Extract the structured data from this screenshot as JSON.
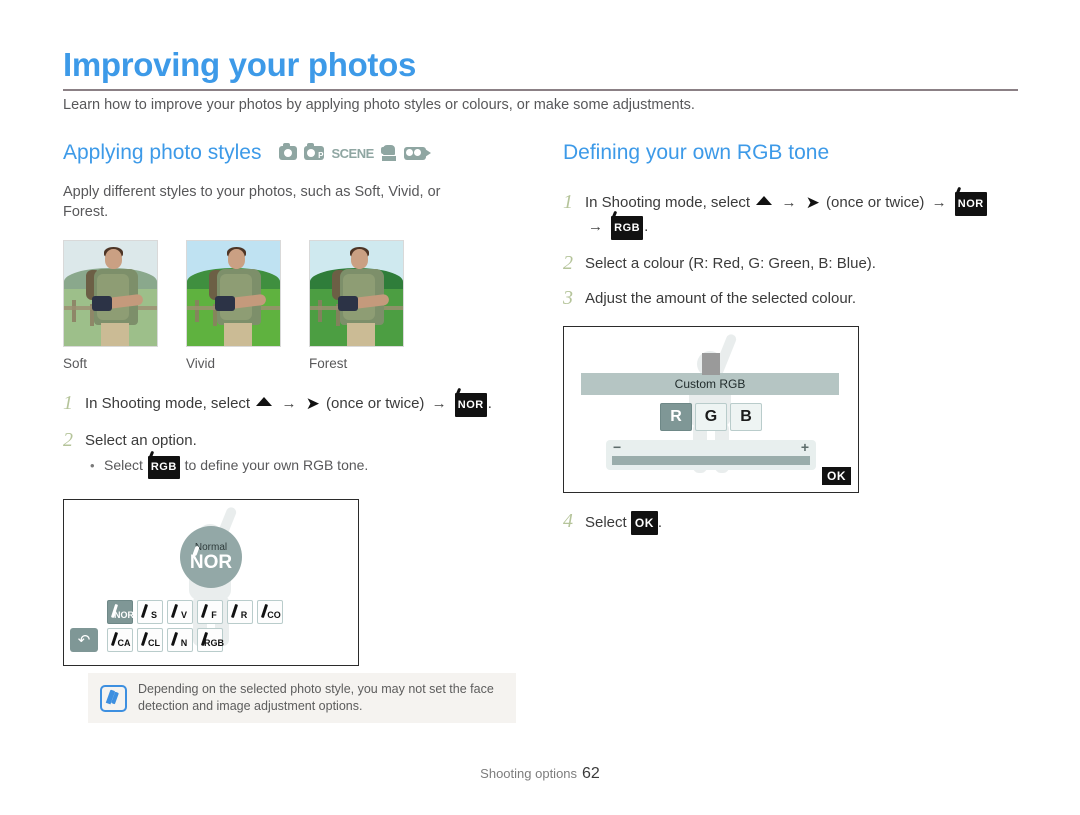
{
  "page": {
    "title": "Improving your photos",
    "intro": "Learn how to improve your photos by applying photo styles or colours, or make some adjustments.",
    "footer_label": "Shooting options",
    "footer_page": "62",
    "accent_color": "#3d9ae8",
    "rule_color": "#8b8085"
  },
  "left": {
    "section_title": "Applying photo styles",
    "mode_icons": [
      "camera-icon",
      "camera-program-icon",
      "scene-icon",
      "dual-is-icon",
      "video-camera-icon"
    ],
    "scene_label": "SCENE",
    "description": "Apply different styles to your photos, such as Soft, Vivid, or Forest.",
    "samples": [
      {
        "label": "Soft",
        "sky": "#dce8ea",
        "hill": "#8aa88c",
        "grass": "#9dbf8a"
      },
      {
        "label": "Vivid",
        "sky": "#bfe2f2",
        "hill": "#3f8f3f",
        "grass": "#5fb23f"
      },
      {
        "label": "Forest",
        "sky": "#cfe9ef",
        "hill": "#2f7d3a",
        "grass": "#4c9e42"
      }
    ],
    "steps": [
      {
        "num": "1",
        "parts": [
          "In Shooting mode, select ",
          "up-icon",
          " → ",
          "right-chevron-icon",
          " (once or twice) → ",
          "nor-icon",
          "."
        ],
        "text_a": "In Shooting mode, select",
        "text_b": "(once or twice)",
        "text_end": "."
      },
      {
        "num": "2",
        "text": "Select an option.",
        "bullet_before": "Select",
        "bullet_after": "to define your own RGB tone.",
        "bullet_icon_label": "RGB"
      }
    ],
    "camera_screen": {
      "selected_label": "Normal",
      "selected_icon": "NOR",
      "style_row_1": [
        "NOR",
        "S",
        "V",
        "F",
        "R",
        "CO"
      ],
      "style_row_2": [
        "CA",
        "CL",
        "N",
        "RGB"
      ],
      "selected_index": 0,
      "back_button": "↶"
    }
  },
  "right": {
    "section_title": "Defining your own RGB tone",
    "steps": [
      {
        "num": "1",
        "text_a": "In Shooting mode, select",
        "text_b": "(once or twice)",
        "icon_nor": "NOR",
        "icon_rgb": "RGB",
        "text_end": "."
      },
      {
        "num": "2",
        "text": "Select a colour (R: Red, G: Green, B: Blue)."
      },
      {
        "num": "3",
        "text": "Adjust the amount of the selected colour."
      },
      {
        "num": "4",
        "text_a": "Select",
        "ok_label": "OK",
        "text_end": "."
      }
    ],
    "rgb_screen": {
      "title": "Custom RGB",
      "buttons": [
        "R",
        "G",
        "B"
      ],
      "selected_button": "R",
      "minus": "−",
      "plus": "+",
      "ok_label": "OK"
    }
  },
  "note": {
    "icon": "note-pencil-icon",
    "text": "Depending on the selected photo style, you may not set the face detection and image adjustment options."
  }
}
